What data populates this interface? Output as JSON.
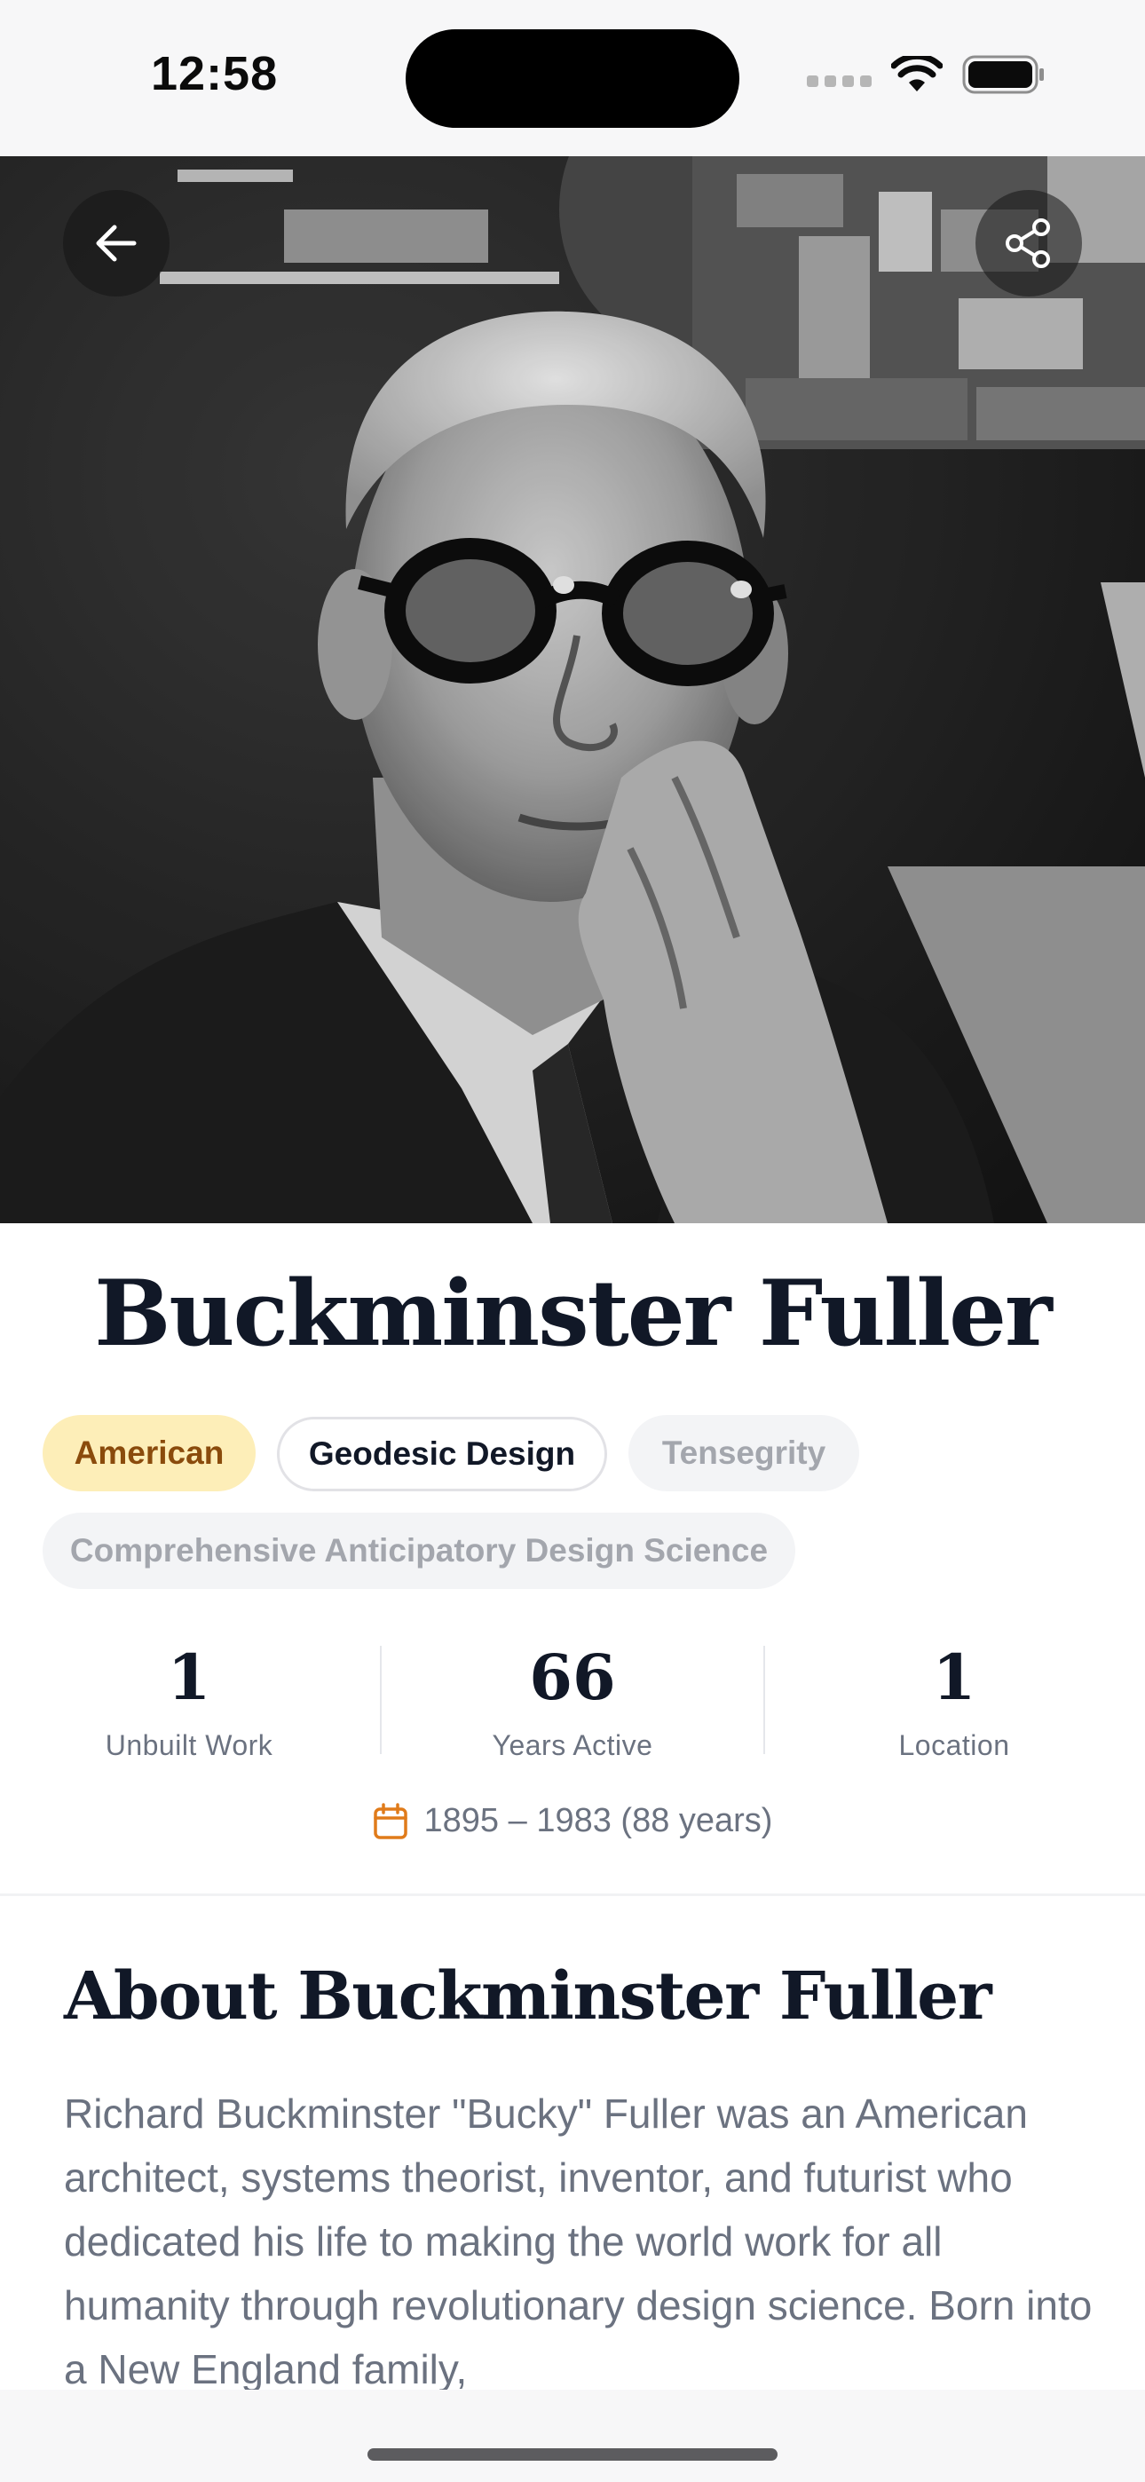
{
  "status_bar": {
    "time": "12:58"
  },
  "header": {
    "back_icon": "arrow-left-icon",
    "share_icon": "share-icon"
  },
  "hero_image": {
    "description_icon": "portrait-photo",
    "style": "black-and-white"
  },
  "artist": {
    "name": "Buckminster Fuller",
    "tags": [
      "American",
      "Geodesic Design",
      "Tensegrity",
      "Comprehensive Anticipatory Design Science"
    ]
  },
  "stats": [
    {
      "value": "1",
      "label": "Unbuilt Work"
    },
    {
      "value": "66",
      "label": "Years Active"
    },
    {
      "value": "1",
      "label": "Location"
    }
  ],
  "lifespan": "1895 – 1983 (88 years)",
  "about": {
    "title": "About Buckminster Fuller",
    "text": "Richard Buckminster \"Bucky\" Fuller was an American architect, systems theorist, inventor, and futurist who dedicated his life to making the world work for all humanity through revolutionary design science. Born into a New England family,"
  },
  "colors": {
    "accent": "#e07b1a",
    "tag_highlight_bg": "#fdeeb8",
    "tag_highlight_text": "#8a4b0c",
    "title_text": "#111827"
  }
}
